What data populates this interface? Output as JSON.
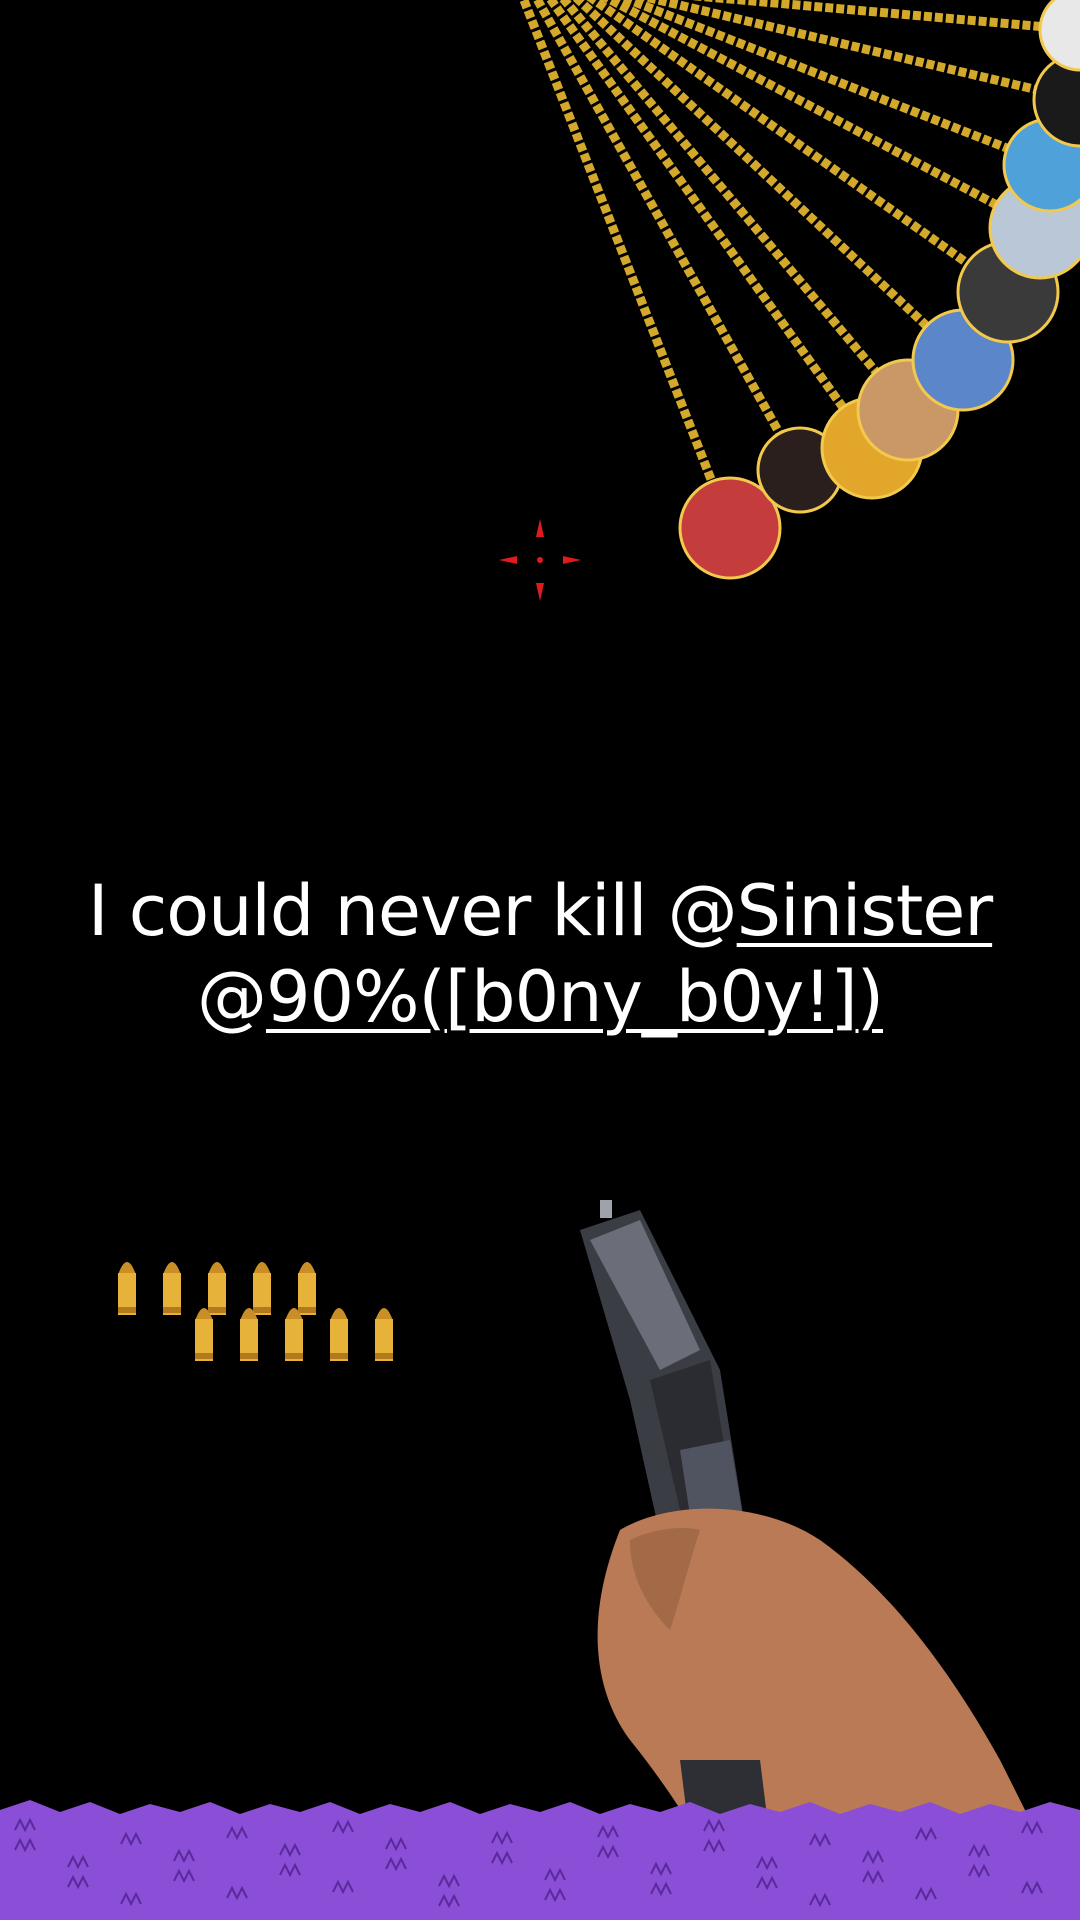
{
  "caption": {
    "prefix": "I could never kill @",
    "mention1": "Sinister",
    "at2": "@",
    "mention2": "90%([b0ny_b0y!])"
  },
  "chain_avatars": [
    {
      "name": "avatar-1",
      "color": "#c43c3c"
    },
    {
      "name": "avatar-2",
      "color": "#2a1f1c"
    },
    {
      "name": "avatar-3",
      "color": "#e2a62b"
    },
    {
      "name": "avatar-4",
      "color": "#c99866"
    },
    {
      "name": "avatar-5",
      "color": "#5b86c9"
    },
    {
      "name": "avatar-6",
      "color": "#3a3a3a"
    },
    {
      "name": "avatar-7",
      "color": "#b9c7d6"
    },
    {
      "name": "avatar-8",
      "color": "#4fa1d9"
    },
    {
      "name": "avatar-9",
      "color": "#1a1a1a"
    },
    {
      "name": "avatar-10",
      "color": "#e8e8e8"
    }
  ],
  "ammo_count": 10,
  "colors": {
    "background": "#000000",
    "chain": "#d4a82a",
    "crosshair": "#e01b1b",
    "grass": "#8a4fd6",
    "bullet": "#e7b23a",
    "caption_text": "#ffffff"
  }
}
